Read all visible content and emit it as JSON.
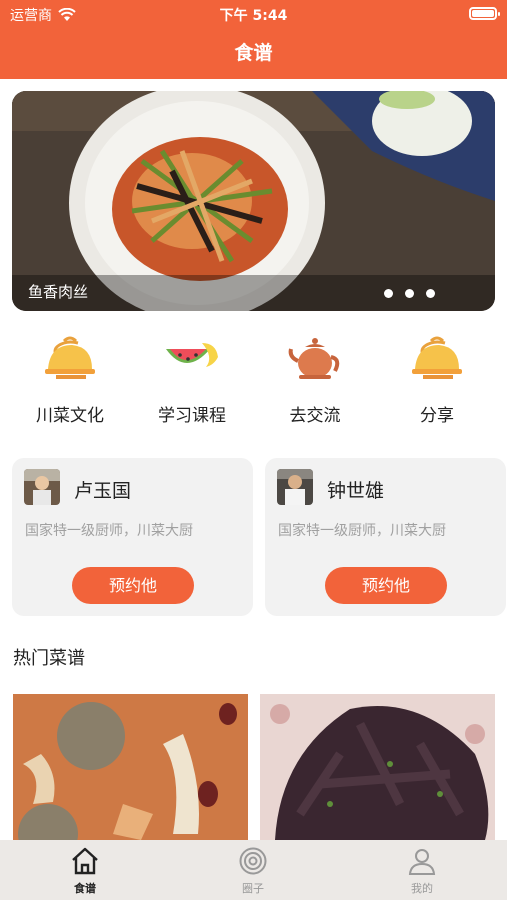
{
  "status": {
    "carrier": "运营商",
    "time": "下午 5:44"
  },
  "header": {
    "title": "食谱"
  },
  "banner": {
    "caption": "鱼香肉丝",
    "page_count": 3
  },
  "categories": [
    {
      "label": "川菜文化",
      "icon": "cloche-icon"
    },
    {
      "label": "学习课程",
      "icon": "watermelon-icon"
    },
    {
      "label": "去交流",
      "icon": "teapot-icon"
    },
    {
      "label": "分享",
      "icon": "cloche-icon"
    }
  ],
  "chefs": [
    {
      "name": "卢玉国",
      "desc": "国家特一级厨师，川菜大厨",
      "button": "预约他"
    },
    {
      "name": "钟世雄",
      "desc": "国家特一级厨师，川菜大厨",
      "button": "预约他"
    }
  ],
  "section": {
    "title": "热门菜谱"
  },
  "tabbar": {
    "items": [
      {
        "label": "食谱",
        "icon": "home-icon",
        "active": true
      },
      {
        "label": "圈子",
        "icon": "circle-icon",
        "active": false
      },
      {
        "label": "我的",
        "icon": "user-icon",
        "active": false
      }
    ]
  },
  "colors": {
    "accent": "#f2633a",
    "card_bg": "#f2f2f2",
    "muted_text": "#a0a0a0"
  }
}
